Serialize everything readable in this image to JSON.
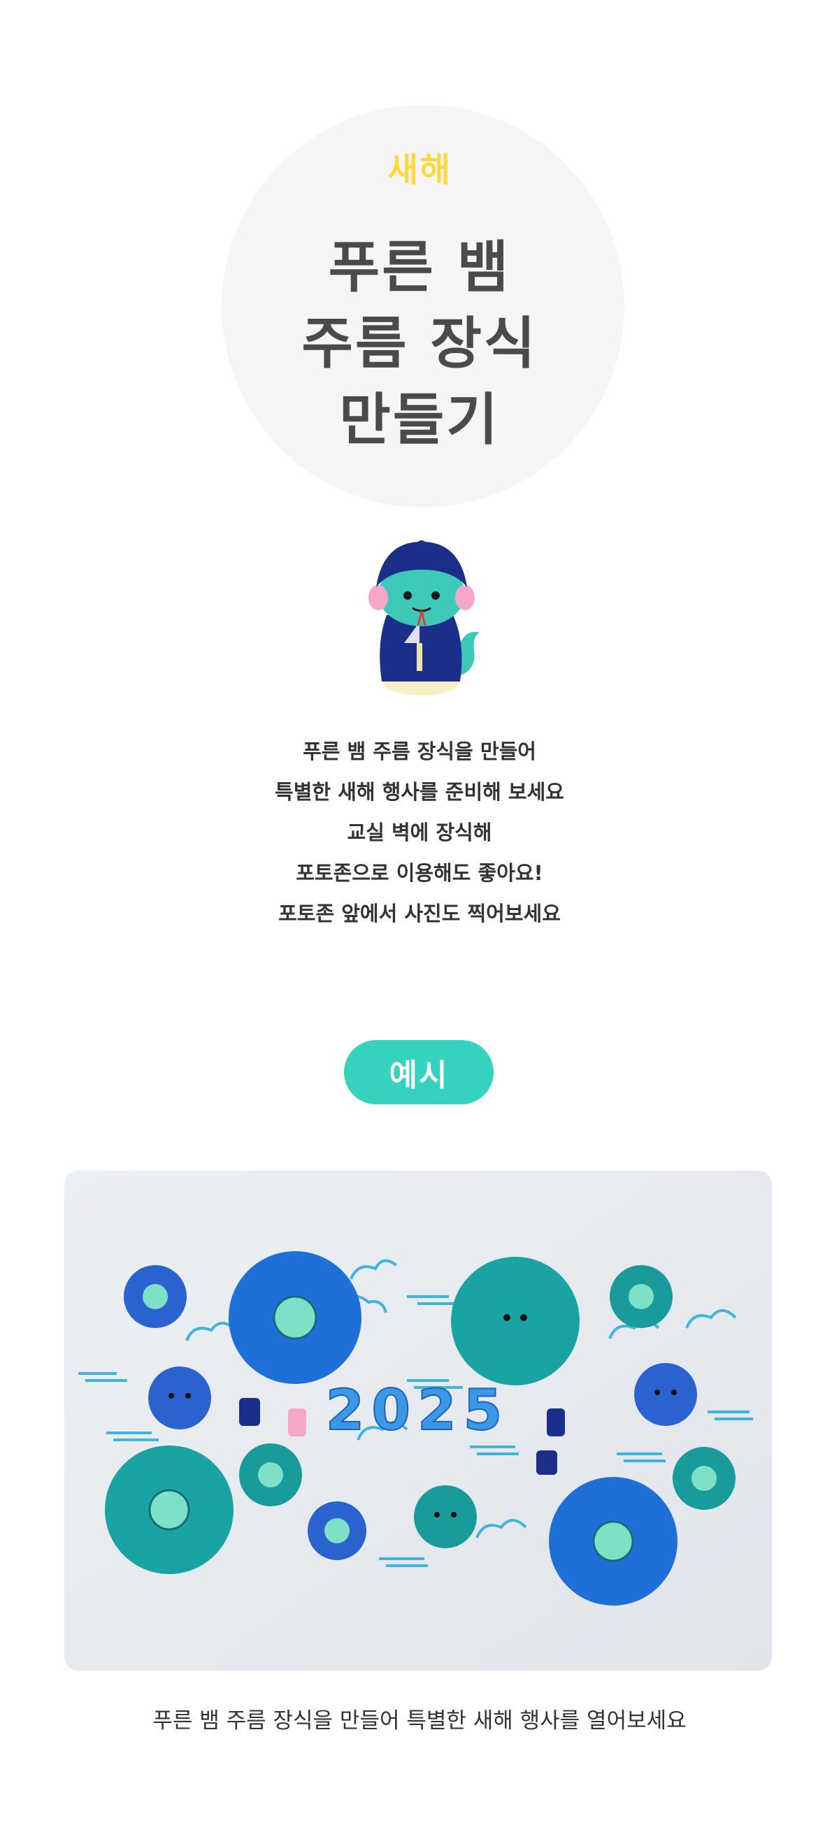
{
  "header": {
    "eyebrow": "새해",
    "title_lines": [
      "푸른 뱀",
      "주름 장식",
      "만들기"
    ]
  },
  "intro": {
    "lines": [
      "푸른 뱀 주름 장식을 만들어",
      "특별한 새해 행사를 준비해 보세요",
      "교실 벽에 장식해",
      "포토존으로 이용해도 좋아요!",
      "포토존 앞에서 사진도 찍어보세요"
    ]
  },
  "example": {
    "badge": "예시",
    "year_text": "2025",
    "caption": "푸른 뱀 주름 장식을 만들어 특별한 새해 행사를 열어보세요"
  },
  "colors": {
    "accent_yellow": "#ffd83a",
    "badge_mint": "#35d2be",
    "royal_blue": "#1f6fd8",
    "teal": "#1aa3a3",
    "cloud_blue": "#4cb6e0"
  }
}
